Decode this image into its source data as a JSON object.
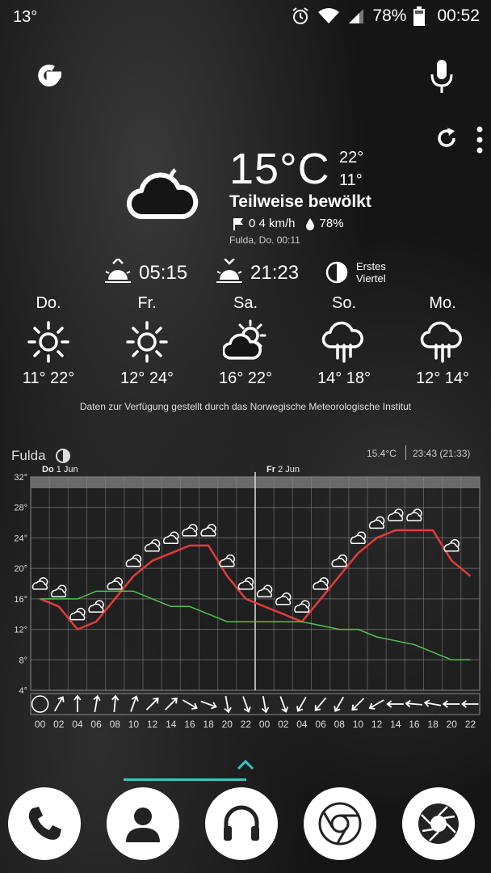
{
  "status_bar": {
    "left_text": "13°",
    "battery": "78%",
    "time": "00:52"
  },
  "widget": {
    "temperature": "15°C",
    "high": "22°",
    "low": "11°",
    "condition": "Teilweise bewölkt",
    "wind": "0 4 km/h",
    "humidity": "78%",
    "location_time": "Fulda, Do. 00:11",
    "sunrise": "05:15",
    "sunset": "21:23",
    "moon_phase_line1": "Erstes",
    "moon_phase_line2": "Viertel"
  },
  "forecast": [
    {
      "day": "Do.",
      "icon": "sun-icon",
      "temps": "11° 22°"
    },
    {
      "day": "Fr.",
      "icon": "sun-icon",
      "temps": "12° 24°"
    },
    {
      "day": "Sa.",
      "icon": "partly-cloudy-icon",
      "temps": "16° 22°"
    },
    {
      "day": "So.",
      "icon": "rain-cloud-icon",
      "temps": "14° 18°"
    },
    {
      "day": "Mo.",
      "icon": "rain-cloud-icon",
      "temps": "12° 14°"
    }
  ],
  "credit": "Daten zur Verfügung gestellt durch das Norwegische Meteorologische Institut",
  "chart_header": {
    "location": "Fulda",
    "current_temp": "15.4°C",
    "time_info": "23:43 (21:33)",
    "day1_label": "Do",
    "day1_date": "1 Jun",
    "day2_label": "Fr",
    "day2_date": "2 Jun"
  },
  "chart_data": {
    "type": "line",
    "ylim": [
      4,
      32
    ],
    "y_ticks": [
      "32°",
      "28°",
      "24°",
      "20°",
      "16°",
      "12°",
      "8°",
      "4°"
    ],
    "x_ticks": [
      "00",
      "02",
      "04",
      "06",
      "08",
      "10",
      "12",
      "14",
      "16",
      "18",
      "20",
      "22",
      "00",
      "02",
      "04",
      "06",
      "08",
      "10",
      "12",
      "14",
      "16",
      "18",
      "20",
      "22"
    ],
    "series": [
      {
        "color": "#e33b3b",
        "values": [
          16,
          15,
          12,
          13,
          16,
          19,
          21,
          22,
          23,
          23,
          19,
          16,
          15,
          14,
          13,
          16,
          19,
          22,
          24,
          25,
          25,
          25,
          21,
          19
        ]
      },
      {
        "color": "#4fc24f",
        "values": [
          16,
          16,
          16,
          17,
          17,
          17,
          16,
          15,
          15,
          14,
          13,
          13,
          13,
          13,
          13,
          12.5,
          12,
          12,
          11,
          10.5,
          10,
          9,
          8,
          8
        ]
      }
    ],
    "wind_arrows_deg": [
      null,
      210,
      180,
      190,
      185,
      200,
      225,
      225,
      300,
      290,
      350,
      340,
      350,
      340,
      30,
      40,
      30,
      45,
      60,
      90,
      95,
      100,
      90,
      90
    ],
    "colors": {
      "temp": "#e33b3b",
      "dewpoint": "#4fc24f",
      "grid": "#8a8a8a"
    }
  },
  "dock": [
    {
      "name": "phone-icon"
    },
    {
      "name": "contacts-icon"
    },
    {
      "name": "music-icon"
    },
    {
      "name": "browser-icon"
    },
    {
      "name": "camera-icon"
    }
  ]
}
